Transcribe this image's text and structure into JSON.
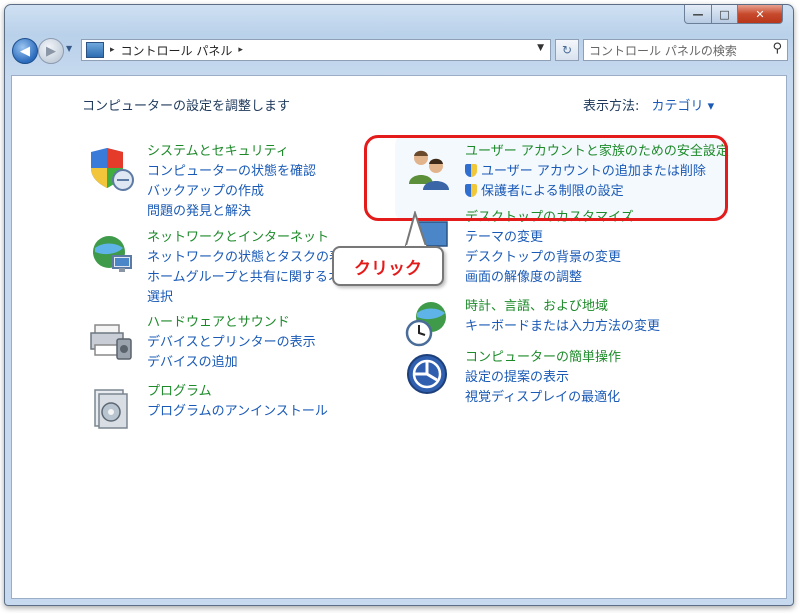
{
  "window": {
    "min_label": "—",
    "max_label": "□",
    "close_label": "✕"
  },
  "nav": {
    "back_glyph": "◀",
    "forward_glyph": "▶",
    "recent_glyph": "▼"
  },
  "address": {
    "root_sep": "▸",
    "path": "コントロール パネル",
    "trail_sep": "▸",
    "dropdown": "▼"
  },
  "refresh_glyph": "↻",
  "search": {
    "placeholder": "コントロール パネルの検索",
    "icon": "search-icon",
    "glyph": "⚲"
  },
  "content": {
    "heading": "コンピューターの設定を調整します",
    "view_by_label": "表示方法:",
    "view_by_value": "カテゴリ ▾"
  },
  "categories": {
    "system": {
      "title": "システムとセキュリティ",
      "links": [
        "コンピューターの状態を確認",
        "バックアップの作成",
        "問題の発見と解決"
      ]
    },
    "network": {
      "title": "ネットワークとインターネット",
      "links": [
        "ネットワークの状態とタスクの表示",
        "ホームグループと共有に関するオプ",
        "選択"
      ]
    },
    "hardware": {
      "title": "ハードウェアとサウンド",
      "links": [
        "デバイスとプリンターの表示",
        "デバイスの追加"
      ]
    },
    "programs": {
      "title": "プログラム",
      "links": [
        "プログラムのアンインストール"
      ]
    },
    "users": {
      "title": "ユーザー アカウントと家族のための安全設定",
      "links": [
        "ユーザー アカウントの追加または削除",
        "保護者による制限の設定"
      ]
    },
    "appearance": {
      "title": "デスクトップのカスタマイズ",
      "links": [
        "テーマの変更",
        "デスクトップの背景の変更",
        "画面の解像度の調整"
      ]
    },
    "clock": {
      "title": "時計、言語、および地域",
      "links": [
        "キーボードまたは入力方法の変更"
      ]
    },
    "ease": {
      "title": "コンピューターの簡単操作",
      "links": [
        "設定の提案の表示",
        "視覚ディスプレイの最適化"
      ]
    }
  },
  "annotation": {
    "callout_text": "クリック",
    "color": "#e41b1b"
  },
  "colors": {
    "title_green": "#1d8a2a",
    "link_blue": "#1a5ab6",
    "heading": "#1e395b"
  }
}
